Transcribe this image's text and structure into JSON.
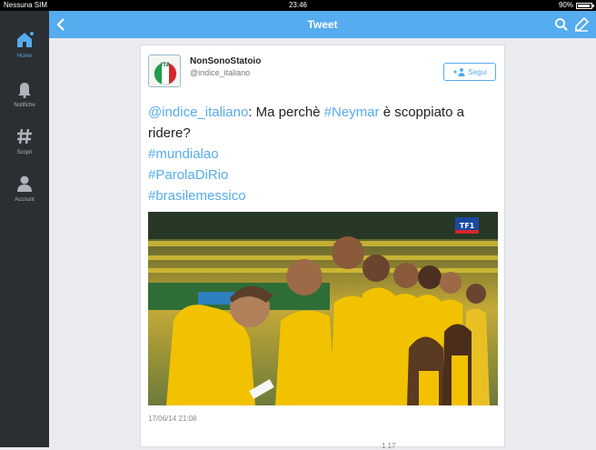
{
  "statusbar": {
    "carrier": "Nessuna SIM",
    "time": "23:46",
    "battery": "90%",
    "battery_level": 0.9
  },
  "sidebar": {
    "items": [
      {
        "label": "Home",
        "icon": "home-icon",
        "active": true
      },
      {
        "label": "Notifiche",
        "icon": "bell-icon",
        "active": false
      },
      {
        "label": "Scopri",
        "icon": "hashtag-icon",
        "active": false
      },
      {
        "label": "Account",
        "icon": "person-icon",
        "active": false
      }
    ]
  },
  "topbar": {
    "title": "Tweet",
    "back_icon": "chevron-left-icon",
    "search_icon": "search-icon",
    "compose_icon": "compose-icon"
  },
  "tweet": {
    "name": "NonSonoStatoio",
    "handle": "@indice_italiano",
    "avatar_text": "ITA",
    "follow_label": "Segui",
    "text": {
      "mention": "@indice_italiano",
      "part1": ": Ma perchè ",
      "hashtag1": "#Neymar",
      "part2": " è scoppiato a",
      "part3": "ridere?",
      "hashtag2": "#mundialao",
      "hashtag3": "#ParolaDiRio",
      "hashtag4": "#brasilemessico"
    },
    "photo_logo": "TF1",
    "timestamp": "17/06/14 21:08",
    "actions_text": "1    17"
  },
  "colors": {
    "accent": "#55acee",
    "sidebar_bg": "#2b2f33",
    "jersey": "#f2c200"
  }
}
